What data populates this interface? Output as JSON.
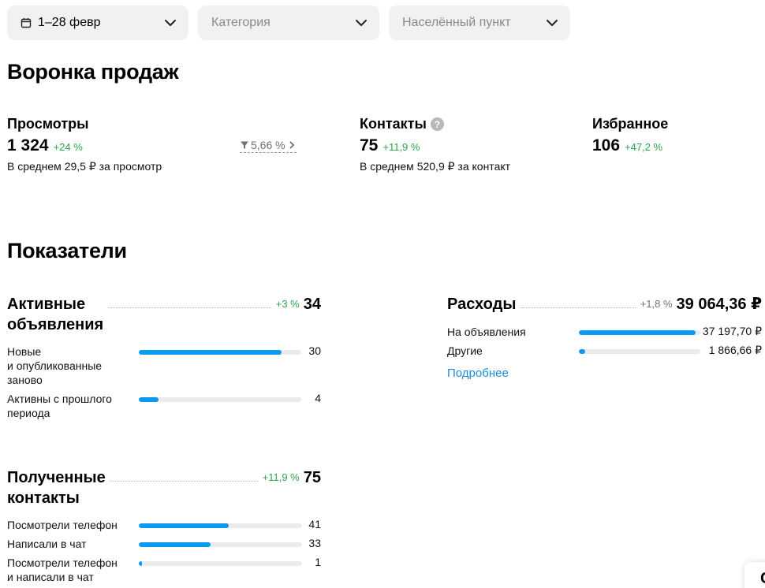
{
  "filters": {
    "date_label": "1–28 февр",
    "category_placeholder": "Категория",
    "city_placeholder": "Населённый пункт"
  },
  "funnel": {
    "title": "Воронка продаж",
    "views": {
      "label": "Просмотры",
      "value": "1 324",
      "delta": "+24 %",
      "sub": "В среднем 29,5 ₽ за просмотр"
    },
    "conversion": "5,66 %",
    "contacts": {
      "label": "Контакты",
      "help": "?",
      "value": "75",
      "delta": "+11,9 %",
      "sub": "В среднем 520,9 ₽ за контакт"
    },
    "favorites": {
      "label": "Избранное",
      "value": "106",
      "delta": "+47,2 %"
    }
  },
  "indicators": {
    "title": "Показатели",
    "active": {
      "title_line1": "Активные",
      "title_line2": "объявления",
      "delta": "+3 %",
      "value": "34",
      "rows": [
        {
          "label": "Новые\nи опубликованные\nзаново",
          "value": "30",
          "fraction": 0.88
        },
        {
          "label": "Активны с прошлого\nпериода",
          "value": "4",
          "fraction": 0.12
        }
      ]
    },
    "contacts": {
      "title_line1": "Полученные",
      "title_line2": "контакты",
      "delta": "+11,9 %",
      "value": "75",
      "rows": [
        {
          "label": "Посмотрели телефон",
          "value": "41",
          "fraction": 0.55
        },
        {
          "label": "Написали в чат",
          "value": "33",
          "fraction": 0.44
        },
        {
          "label": "Посмотрели телефон\nи написали в чат",
          "value": "1",
          "fraction": 0.02
        }
      ]
    },
    "expenses": {
      "title": "Расходы",
      "delta": "+1,8 %",
      "value": "39 064,36 ₽",
      "rows": [
        {
          "label": "На объявления",
          "value": "37 197,70 ₽",
          "fraction": 0.96
        },
        {
          "label": "Другие",
          "value": "1 866,66 ₽",
          "fraction": 0.05
        }
      ],
      "more_label": "Подробнее"
    }
  },
  "corner_glyph": "С",
  "colors": {
    "accent": "#0a9bf0",
    "positive": "#2ea44f",
    "link": "#1a8cdc"
  }
}
